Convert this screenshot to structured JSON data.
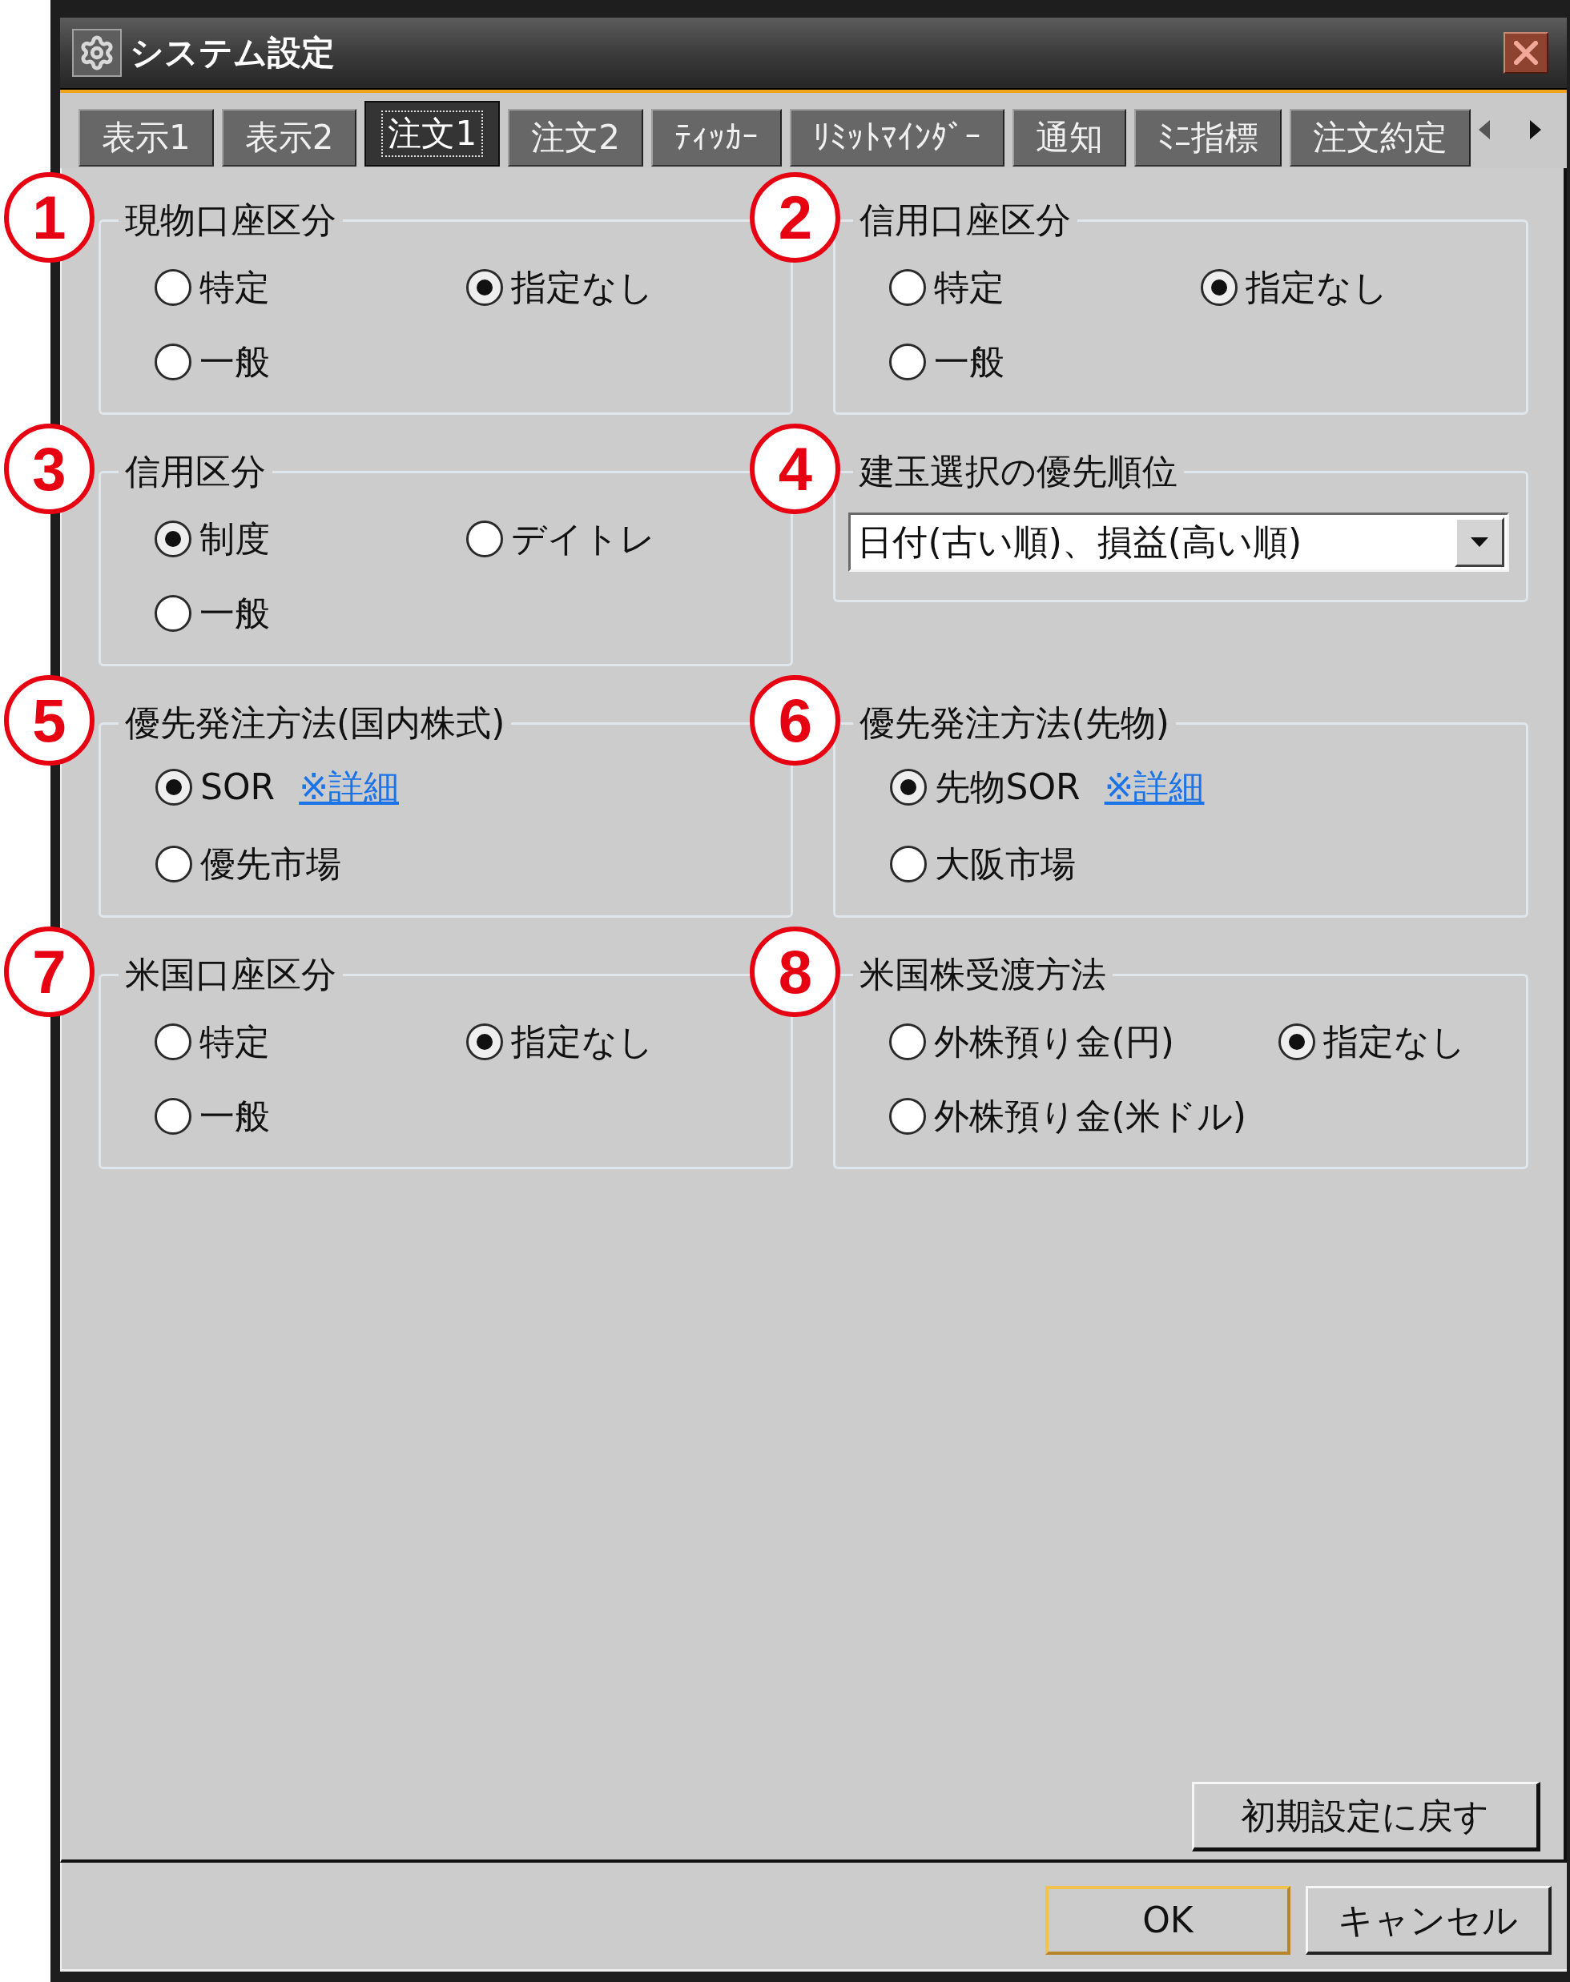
{
  "window": {
    "title": "システム設定"
  },
  "tabs": [
    {
      "label": "表示1",
      "selected": false
    },
    {
      "label": "表示2",
      "selected": false
    },
    {
      "label": "注文1",
      "selected": true
    },
    {
      "label": "注文2",
      "selected": false
    },
    {
      "label": "ﾃｨｯｶｰ",
      "selected": false
    },
    {
      "label": "ﾘﾐｯﾄﾏｲﾝﾀﾞｰ",
      "selected": false
    },
    {
      "label": "通知",
      "selected": false
    },
    {
      "label": "ﾐﾆ指標",
      "selected": false
    },
    {
      "label": "注文約定",
      "selected": false
    }
  ],
  "groups": [
    {
      "annotation": "1",
      "legend": "現物口座区分",
      "kind": "radio_grid",
      "options": [
        {
          "label": "特定",
          "selected": false
        },
        {
          "label": "指定なし",
          "selected": true
        },
        {
          "label": "一般",
          "selected": false
        }
      ]
    },
    {
      "annotation": "2",
      "legend": "信用口座区分",
      "kind": "radio_grid",
      "options": [
        {
          "label": "特定",
          "selected": false
        },
        {
          "label": "指定なし",
          "selected": true
        },
        {
          "label": "一般",
          "selected": false
        }
      ]
    },
    {
      "annotation": "3",
      "legend": "信用区分",
      "kind": "radio_grid",
      "options": [
        {
          "label": "制度",
          "selected": true
        },
        {
          "label": "デイトレ",
          "selected": false
        },
        {
          "label": "一般",
          "selected": false
        }
      ]
    },
    {
      "annotation": "4",
      "legend": "建玉選択の優先順位",
      "kind": "dropdown",
      "value": "日付(古い順)、損益(高い順)"
    },
    {
      "annotation": "5",
      "legend": "優先発注方法(国内株式)",
      "kind": "radio_stack",
      "options": [
        {
          "label": "SOR",
          "selected": true,
          "link": "※詳細"
        },
        {
          "label": "優先市場",
          "selected": false
        }
      ]
    },
    {
      "annotation": "6",
      "legend": "優先発注方法(先物)",
      "kind": "radio_stack",
      "options": [
        {
          "label": "先物SOR",
          "selected": true,
          "link": "※詳細"
        },
        {
          "label": "大阪市場",
          "selected": false
        }
      ]
    },
    {
      "annotation": "7",
      "legend": "米国口座区分",
      "kind": "radio_grid",
      "options": [
        {
          "label": "特定",
          "selected": false
        },
        {
          "label": "指定なし",
          "selected": true
        },
        {
          "label": "一般",
          "selected": false
        }
      ]
    },
    {
      "annotation": "8",
      "legend": "米国株受渡方法",
      "kind": "radio_grid",
      "options": [
        {
          "label": "外株預り金(円)",
          "selected": false
        },
        {
          "label": "指定なし",
          "selected": true
        },
        {
          "label": "外株預り金(米ドル)",
          "selected": false
        }
      ]
    }
  ],
  "reset_button": {
    "label": "初期設定に戻す"
  },
  "buttons": [
    {
      "label": "OK",
      "default": true
    },
    {
      "label": "キャンセル",
      "default": false
    }
  ]
}
